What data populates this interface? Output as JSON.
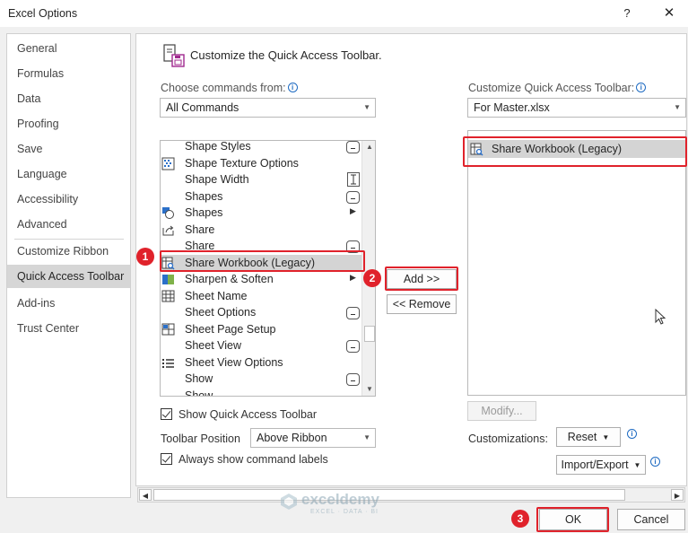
{
  "window": {
    "title": "Excel Options",
    "help": "?",
    "close": "✕"
  },
  "nav": {
    "items": [
      "General",
      "Formulas",
      "Data",
      "Proofing",
      "Save",
      "Language",
      "Accessibility",
      "Advanced",
      "Customize Ribbon",
      "Quick Access Toolbar",
      "Add-ins",
      "Trust Center"
    ],
    "active": "Quick Access Toolbar"
  },
  "header": {
    "title": "Customize the Quick Access Toolbar."
  },
  "choose": {
    "label": "Choose commands from:",
    "value": "All Commands"
  },
  "customize": {
    "label": "Customize Quick Access Toolbar:",
    "value": "For Master.xlsx"
  },
  "commands": [
    {
      "label": "Shape Styles",
      "icon": "",
      "marker": "dropdown"
    },
    {
      "label": "Shape Texture Options",
      "icon": "texture-icon",
      "marker": ""
    },
    {
      "label": "Shape Width",
      "icon": "",
      "marker": "spin"
    },
    {
      "label": "Shapes",
      "icon": "",
      "marker": "dropdown"
    },
    {
      "label": "Shapes",
      "icon": "shapes-icon",
      "marker": "submenu"
    },
    {
      "label": "Share",
      "icon": "share-icon",
      "marker": ""
    },
    {
      "label": "Share",
      "icon": "",
      "marker": "dropdown"
    },
    {
      "label": "Share Workbook (Legacy)",
      "icon": "share-workbook-icon",
      "marker": "",
      "selected": true
    },
    {
      "label": "Sharpen & Soften",
      "icon": "sharpen-icon",
      "marker": "submenu"
    },
    {
      "label": "Sheet Name",
      "icon": "sheet-name-icon",
      "marker": ""
    },
    {
      "label": "Sheet Options",
      "icon": "",
      "marker": "dropdown"
    },
    {
      "label": "Sheet Page Setup",
      "icon": "page-setup-icon",
      "marker": ""
    },
    {
      "label": "Sheet View",
      "icon": "",
      "marker": "dropdown"
    },
    {
      "label": "Sheet View Options",
      "icon": "view-options-icon",
      "marker": ""
    },
    {
      "label": "Show",
      "icon": "",
      "marker": "dropdown"
    },
    {
      "label": "Show",
      "icon": "",
      "marker": ""
    }
  ],
  "toolbar_items": [
    {
      "label": "Share Workbook (Legacy)",
      "icon": "share-workbook-icon"
    }
  ],
  "buttons": {
    "add": "Add >>",
    "remove": "<< Remove",
    "modify": "Modify...",
    "reset": "Reset",
    "import_export": "Import/Export",
    "ok": "OK",
    "cancel": "Cancel"
  },
  "options": {
    "show_qat": {
      "label": "Show Quick Access Toolbar",
      "checked": true
    },
    "position": {
      "label": "Toolbar Position",
      "value": "Above Ribbon"
    },
    "always_labels": {
      "label": "Always show command labels",
      "checked": true
    },
    "customizations_label": "Customizations:"
  },
  "annotations": {
    "step1": "1",
    "step2": "2",
    "step3": "3",
    "color": "#e0222b"
  },
  "watermark": {
    "name": "exceldemy",
    "tagline": "EXCEL · DATA · BI"
  }
}
